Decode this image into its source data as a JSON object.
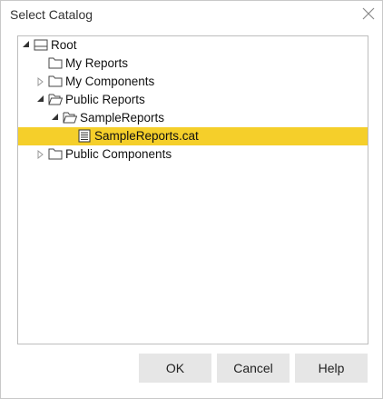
{
  "dialog": {
    "title": "Select Catalog"
  },
  "tree": {
    "items": [
      {
        "label": "Root"
      },
      {
        "label": "My Reports"
      },
      {
        "label": "My Components"
      },
      {
        "label": "Public Reports"
      },
      {
        "label": "SampleReports"
      },
      {
        "label": "SampleReports.cat",
        "selected": true
      },
      {
        "label": "Public Components"
      }
    ]
  },
  "buttons": {
    "ok": "OK",
    "cancel": "Cancel",
    "help": "Help"
  },
  "colors": {
    "selection": "#f5cf2a",
    "button_bg": "#e6e6e6"
  }
}
